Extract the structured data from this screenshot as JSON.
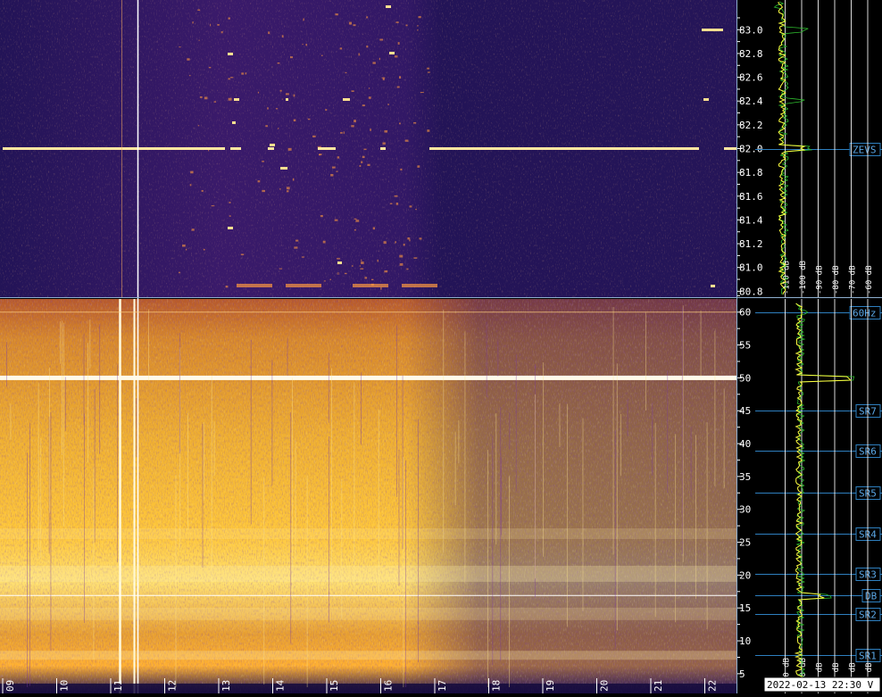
{
  "timestamp": "2022-02-13 22:30 V",
  "time_axis": {
    "labels": [
      "09",
      "10",
      "11",
      "12",
      "13",
      "14",
      "15",
      "16",
      "17",
      "18",
      "19",
      "20",
      "21",
      "22"
    ]
  },
  "upper_panel": {
    "freq_labels": [
      "83.0",
      "82.8",
      "82.6",
      "82.4",
      "82.2",
      "82.0",
      "81.8",
      "81.6",
      "81.4",
      "81.2",
      "81.0",
      "80.8"
    ],
    "freq_values": [
      83.0,
      82.8,
      82.6,
      82.4,
      82.2,
      82.0,
      81.8,
      81.6,
      81.4,
      81.2,
      81.0,
      80.8
    ],
    "freq_range": [
      80.75,
      83.25
    ],
    "markers": [
      {
        "label": "ZEVS",
        "freq": 82.0
      }
    ],
    "db_labels": [
      "-110 dB",
      "-100 dB",
      "-90 dB",
      "-80 dB",
      "-70 dB",
      "-60 dB"
    ]
  },
  "lower_panel": {
    "freq_labels": [
      "60",
      "55",
      "50",
      "45",
      "40",
      "35",
      "30",
      "25",
      "20",
      "15",
      "10",
      "5"
    ],
    "freq_values": [
      60,
      55,
      50,
      45,
      40,
      35,
      30,
      25,
      20,
      15,
      10,
      5
    ],
    "freq_range": [
      2,
      62
    ],
    "markers": [
      {
        "label": "60Hz",
        "freq": 60
      },
      {
        "label": "SR7",
        "freq": 45
      },
      {
        "label": "SR6",
        "freq": 38.9
      },
      {
        "label": "SR5",
        "freq": 32.6
      },
      {
        "label": "SR4",
        "freq": 26.3
      },
      {
        "label": "SR3",
        "freq": 20.2
      },
      {
        "label": "DB",
        "freq": 16.9
      },
      {
        "label": "SR2",
        "freq": 14.1
      },
      {
        "label": "SR1",
        "freq": 7.8
      }
    ],
    "db_labels": [
      "-110 dB",
      "-100 dB",
      "-90 dB",
      "-80 dB",
      "-70 dB",
      "-60 dB"
    ]
  },
  "colors": {
    "background": "#000000",
    "spectrogram_low": "#1a0f4a",
    "spectrogram_high": "#ffd73a",
    "trace": "#ffff40",
    "trace_alt": "#2fbf2f",
    "marker_line": "#2e7fbf",
    "marker_text": "#5aa7e6",
    "axis_text": "#ffffff"
  }
}
